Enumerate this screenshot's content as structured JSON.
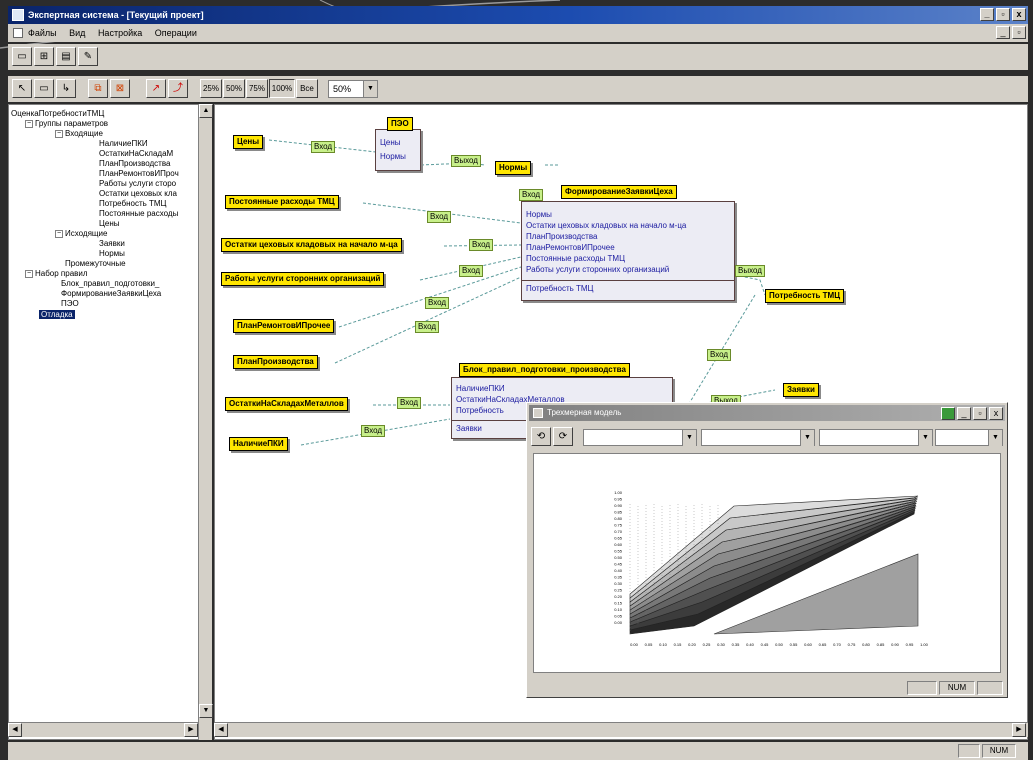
{
  "window": {
    "title": "Экспертная система - [Текущий проект]"
  },
  "menu": [
    "Файлы",
    "Вид",
    "Настройка",
    "Операции"
  ],
  "toolbar": {
    "zoom_buttons": [
      "25%",
      "50%",
      "75%",
      "100%",
      "Все"
    ],
    "zoom_select": "50%"
  },
  "tree": {
    "nodes": [
      {
        "label": "ОценкаПотребностиТМЦ",
        "level": 0,
        "expander": ""
      },
      {
        "label": "Группы параметров",
        "level": 1,
        "expander": "−"
      },
      {
        "label": "Входящие",
        "level": 2,
        "expander": "−"
      },
      {
        "label": "НаличиеПКИ",
        "level": 3,
        "expander": ""
      },
      {
        "label": "ОстаткиНаСкладаМ",
        "level": 3,
        "expander": ""
      },
      {
        "label": "ПланПроизводства",
        "level": 3,
        "expander": ""
      },
      {
        "label": "ПланРемонтовИПроч",
        "level": 3,
        "expander": ""
      },
      {
        "label": "Работы услуги сторо",
        "level": 3,
        "expander": ""
      },
      {
        "label": "Остатки цеховых кла",
        "level": 3,
        "expander": ""
      },
      {
        "label": "Потребность ТМЦ",
        "level": 3,
        "expander": ""
      },
      {
        "label": "Постоянные расходы",
        "level": 3,
        "expander": ""
      },
      {
        "label": "Цены",
        "level": 3,
        "expander": ""
      },
      {
        "label": "Исходящие",
        "level": 2,
        "expander": "−"
      },
      {
        "label": "Заявки",
        "level": 3,
        "expander": ""
      },
      {
        "label": "Нормы",
        "level": 3,
        "expander": ""
      },
      {
        "label": "Промежуточные",
        "level": 2,
        "expander": ""
      },
      {
        "label": "Набор правил",
        "level": 1,
        "expander": "−"
      },
      {
        "label": "Блок_правил_подготовки_",
        "level": 2,
        "expander": ""
      },
      {
        "label": "ФормированиеЗаявкиЦеха",
        "level": 2,
        "expander": ""
      },
      {
        "label": "ПЭО",
        "level": 2,
        "expander": ""
      }
    ],
    "selected": "Отладка"
  },
  "diagram": {
    "inputs": [
      "Цены",
      "Постоянные расходы ТМЦ",
      "Остатки цеховых кладовых на начало м-ца",
      "Работы услуги сторонних организаций",
      "ПланРемонтовИПрочее",
      "ПланПроизводства",
      "ОстаткиНаСкладахМеталлов",
      "НаличиеПКИ"
    ],
    "outputs": [
      "Нормы",
      "Потребность ТМЦ",
      "Заявки"
    ],
    "tag_in": "Вход",
    "tag_out": "Выход",
    "peo": {
      "title": "ПЭО",
      "lines": [
        "Цены",
        "Нормы"
      ]
    },
    "form": {
      "title": "ФормированиеЗаявкиЦеха",
      "lines": [
        "Нормы",
        "Остатки цеховых кладовых на начало м-ца",
        "ПланПроизводства",
        "ПланРемонтовИПрочее",
        "Постоянные расходы ТМЦ",
        "Работы услуги сторонних организаций"
      ],
      "output_line": "Потребность ТМЦ"
    },
    "prep": {
      "title": "Блок_правил_подготовки_производства",
      "lines": [
        "НаличиеПКИ",
        "ОстаткиНаСкладахМеталлов",
        "Потребность"
      ],
      "output_line": "Заявки"
    }
  },
  "subwindow": {
    "title": "Трехмерная модель",
    "status": "NUM",
    "chart_data": {
      "type": "surface",
      "y_tick_labels": [
        "1.00",
        "0.95",
        "0.90",
        "0.85",
        "0.80",
        "0.75",
        "0.70",
        "0.65",
        "0.60",
        "0.55",
        "0.50",
        "0.45",
        "0.40",
        "0.35",
        "0.30",
        "0.25",
        "0.20",
        "0.15",
        "0.10",
        "0.05",
        "0.00"
      ],
      "x_tick_labels": [
        "0.00",
        "0.05",
        "0.10",
        "0.15",
        "0.20",
        "0.25",
        "0.30",
        "0.35",
        "0.40",
        "0.45",
        "0.50",
        "0.55",
        "0.60",
        "0.65",
        "0.70",
        "0.75",
        "0.80",
        "0.85",
        "0.90",
        "0.95",
        "1.00"
      ]
    }
  },
  "statusbar": {
    "num": "NUM"
  }
}
